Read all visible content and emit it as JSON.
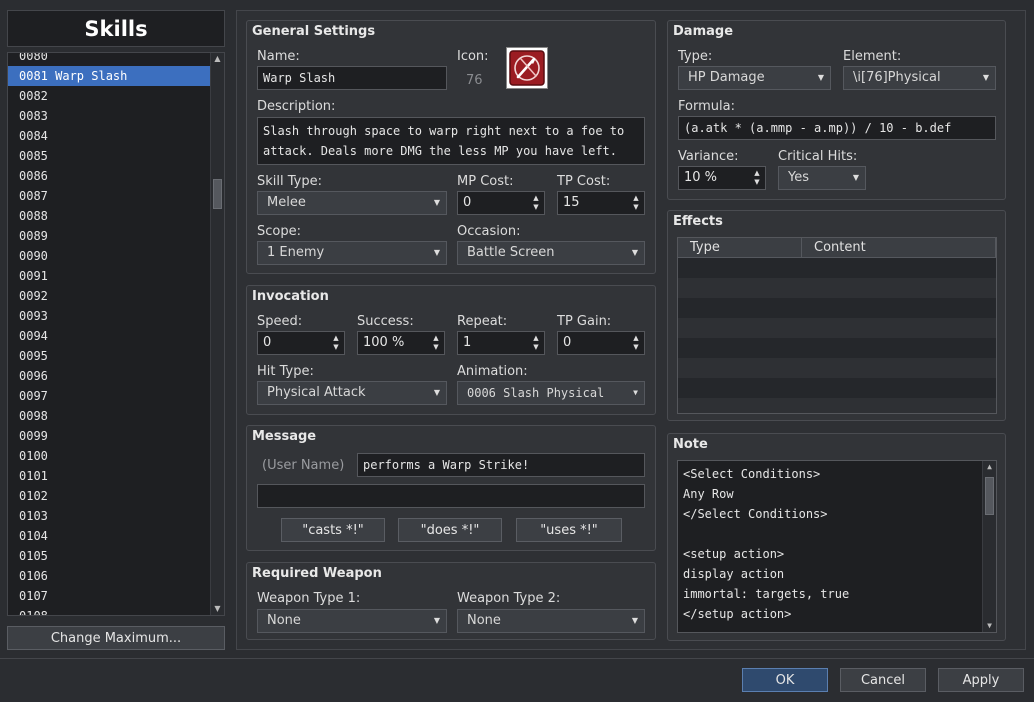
{
  "sidebar": {
    "title": "Skills",
    "top_partial": "0080",
    "items": [
      {
        "label": "0081 Warp Slash",
        "selected": true
      },
      {
        "label": "0082"
      },
      {
        "label": "0083"
      },
      {
        "label": "0084"
      },
      {
        "label": "0085"
      },
      {
        "label": "0086"
      },
      {
        "label": "0087"
      },
      {
        "label": "0088"
      },
      {
        "label": "0089"
      },
      {
        "label": "0090"
      },
      {
        "label": "0091"
      },
      {
        "label": "0092"
      },
      {
        "label": "0093"
      },
      {
        "label": "0094"
      },
      {
        "label": "0095"
      },
      {
        "label": "0096"
      },
      {
        "label": "0097"
      },
      {
        "label": "0098"
      },
      {
        "label": "0099"
      },
      {
        "label": "0100"
      },
      {
        "label": "0101"
      },
      {
        "label": "0102"
      },
      {
        "label": "0103"
      },
      {
        "label": "0104"
      },
      {
        "label": "0105"
      },
      {
        "label": "0106"
      },
      {
        "label": "0107"
      }
    ],
    "bottom_partial": "0108",
    "change_max_label": "Change Maximum..."
  },
  "general": {
    "title": "General Settings",
    "name_label": "Name:",
    "name_value": "Warp Slash",
    "icon_label": "Icon:",
    "icon_index": "76",
    "description_label": "Description:",
    "description_line1": "Slash through space to warp right next to a foe to",
    "description_line2": "attack. Deals more DMG the less MP you have left.",
    "skill_type_label": "Skill Type:",
    "skill_type_value": "Melee",
    "mp_cost_label": "MP Cost:",
    "mp_cost_value": "0",
    "tp_cost_label": "TP Cost:",
    "tp_cost_value": "15",
    "scope_label": "Scope:",
    "scope_value": "1 Enemy",
    "occasion_label": "Occasion:",
    "occasion_value": "Battle Screen"
  },
  "invocation": {
    "title": "Invocation",
    "speed_label": "Speed:",
    "speed_value": "0",
    "success_label": "Success:",
    "success_value": "100 %",
    "repeat_label": "Repeat:",
    "repeat_value": "1",
    "tp_gain_label": "TP Gain:",
    "tp_gain_value": "0",
    "hit_type_label": "Hit Type:",
    "hit_type_value": "Physical Attack",
    "animation_label": "Animation:",
    "animation_value": "0006 Slash Physical"
  },
  "message": {
    "title": "Message",
    "user_name_label": "(User Name)",
    "line1_value": "performs a Warp Strike!",
    "line2_value": "",
    "casts_label": "\"casts *!\"",
    "does_label": "\"does *!\"",
    "uses_label": "\"uses *!\""
  },
  "weapon": {
    "title": "Required Weapon",
    "type1_label": "Weapon Type 1:",
    "type1_value": "None",
    "type2_label": "Weapon Type 2:",
    "type2_value": "None"
  },
  "damage": {
    "title": "Damage",
    "type_label": "Type:",
    "type_value": "HP Damage",
    "element_label": "Element:",
    "element_value": "\\i[76]Physical",
    "formula_label": "Formula:",
    "formula_value": "(a.atk * (a.mmp - a.mp)) / 10 - b.def",
    "variance_label": "Variance:",
    "variance_value": "10 %",
    "critical_label": "Critical Hits:",
    "critical_value": "Yes"
  },
  "effects": {
    "title": "Effects",
    "col_type": "Type",
    "col_content": "Content"
  },
  "note": {
    "title": "Note",
    "lines": [
      "<Select Conditions>",
      "Any Row",
      "</Select Conditions>",
      "",
      "<setup action>",
      "display action",
      "immortal: targets, true",
      "</setup action>"
    ]
  },
  "footer": {
    "ok_label": "OK",
    "cancel_label": "Cancel",
    "apply_label": "Apply"
  },
  "colors": {
    "selection": "#3c6fbf",
    "background": "#2b2d31",
    "icon_red": "#9b1c22"
  }
}
